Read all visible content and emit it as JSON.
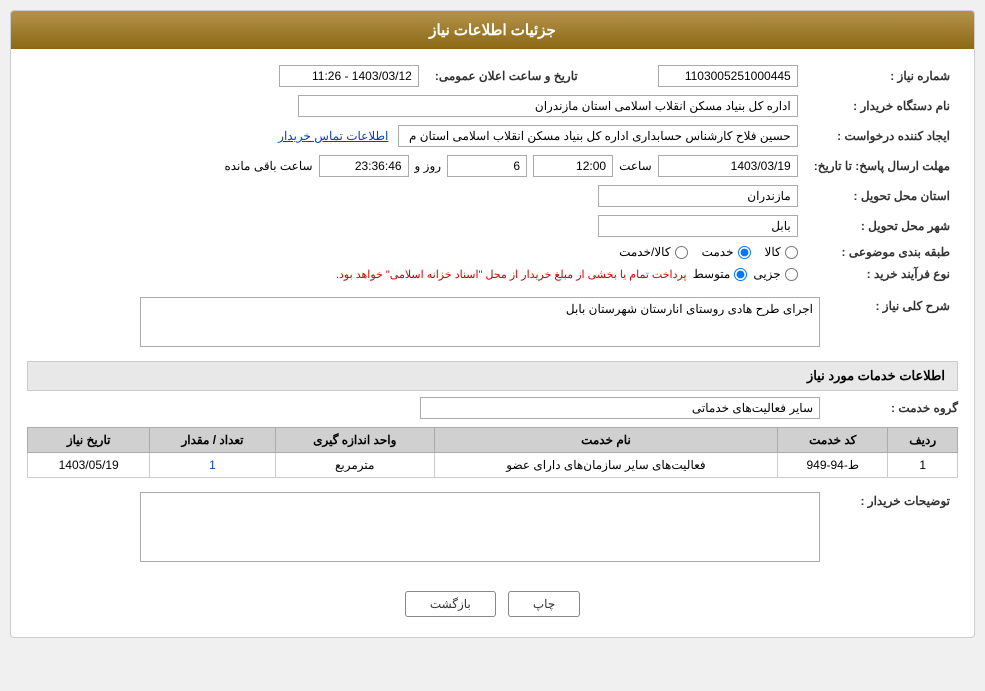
{
  "header": {
    "title": "جزئیات اطلاعات نیاز"
  },
  "fields": {
    "shomareNiaz_label": "شماره نیاز :",
    "shomareNiaz_value": "1103005251000445",
    "namDastgah_label": "نام دستگاه خریدار :",
    "namDastgah_value": "اداره کل بنیاد مسکن انقلاب اسلامی استان مازندران",
    "ijadKonande_label": "ایجاد کننده درخواست :",
    "ijadKonande_value": "حسین فلاح کارشناس حسابداری اداره کل بنیاد مسکن انقلاب اسلامی استان م",
    "etelaat_link": "اطلاعات تماس خریدار",
    "mohlat_label": "مهلت ارسال پاسخ: تا تاریخ:",
    "tarikh_value": "1403/03/19",
    "saat_label": "ساعت",
    "saat_value": "12:00",
    "rooz_label": "روز و",
    "rooz_value": "6",
    "mande_label": "ساعت باقی مانده",
    "mande_value": "23:36:46",
    "tarikh_elan_label": "تاریخ و ساعت اعلان عمومی:",
    "tarikh_elan_value": "1403/03/12 - 11:26",
    "ostan_label": "استان محل تحویل :",
    "ostan_value": "مازندران",
    "shahr_label": "شهر محل تحویل :",
    "shahr_value": "بابل",
    "tabaqe_label": "طبقه بندی موضوعی :",
    "tabaqe_kala": "کالا",
    "tabaqe_khedmat": "خدمت",
    "tabaqe_kala_khedmat": "کالا/خدمت",
    "tabaqe_selected": "khedmat",
    "noeFarayand_label": "نوع فرآیند خرید :",
    "noeFarayand_jazzi": "جزیی",
    "noeFarayand_motavaset": "متوسط",
    "noeFarayand_note": "پرداخت تمام یا بخشی از مبلغ خریدار از محل \"اسناد خزانه اسلامی\" خواهد بود.",
    "noeFarayand_selected": "motavaset",
    "sharh_label": "شرح کلی نیاز :",
    "sharh_value": "اجرای طرح هادی روستای انارستان شهرستان بابل",
    "khadamat_section": "اطلاعات خدمات مورد نیاز",
    "grohe_khedmat_label": "گروه خدمت :",
    "grohe_khedmat_value": "سایر فعالیت‌های خدماتی",
    "services_table": {
      "headers": [
        "ردیف",
        "کد خدمت",
        "نام خدمت",
        "واحد اندازه گیری",
        "تعداد / مقدار",
        "تاریخ نیاز"
      ],
      "rows": [
        {
          "radif": "1",
          "kod": "ط-94-949",
          "nam": "فعالیت‌های سایر سازمان‌های دارای عضو",
          "vahed": "مترمربع",
          "tedad": "1",
          "tarikh": "1403/05/19"
        }
      ]
    },
    "tozihat_label": "توضیحات خریدار :",
    "tozihat_value": ""
  },
  "buttons": {
    "print_label": "چاپ",
    "back_label": "بازگشت"
  }
}
